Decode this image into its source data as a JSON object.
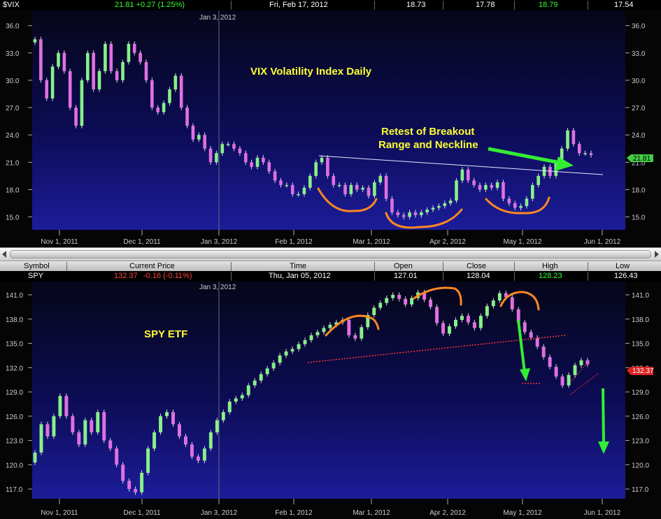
{
  "vix_header": {
    "symbol": "$VIX",
    "change": "21.81 +0.27 (1.25%)",
    "date": "Fri, Feb 17, 2012",
    "open": "18.73",
    "low": "17.78",
    "high": "18.79",
    "close": "17.54"
  },
  "spy_columns": {
    "symbol": "Symbol",
    "current_price": "Current Price",
    "time": "Time",
    "open": "Open",
    "close": "Close",
    "high": "High",
    "low": "Low"
  },
  "spy_header": {
    "symbol": "SPY",
    "price": "132.37",
    "change": "-0.16 (-0.11%)",
    "time": "Thu, Jan 05, 2012",
    "open": "127.01",
    "close": "128.04",
    "high": "128.23",
    "low": "126.43"
  },
  "colors": {
    "background_top": "#0a0a1a",
    "background_bottom": "#16168a",
    "up_candle": "#88f088",
    "down_candle": "#e070e0",
    "annotation_text": "#ffff33",
    "arrow": "#33ee33",
    "arc": "#ff8822",
    "trendline": "#ff3333"
  },
  "chart_data": [
    {
      "type": "candlestick",
      "title": "VIX Volatility Index Daily",
      "annotations": [
        "Retest of Breakout",
        "Range and Neckline"
      ],
      "date_line_label": "Jan 3, 2012",
      "x_ticks": [
        "Nov 1, 2011",
        "Dec 1, 2011",
        "Jan 3, 2012",
        "Feb 1, 2012",
        "Mar 1, 2012",
        "Apr 2, 2012",
        "May 1, 2012",
        "Jun 1, 2012"
      ],
      "y_ticks": [
        "15.0",
        "18.0",
        "21.0",
        "24.0",
        "27.0",
        "30.0",
        "33.0",
        "36.0"
      ],
      "ylim": [
        14.2,
        37.2
      ],
      "last_price_label": "21.81",
      "last_price": 21.81,
      "closes": [
        34.5,
        30,
        28,
        31.5,
        33,
        31,
        27,
        25,
        30,
        33,
        29,
        31,
        34,
        31,
        30,
        32,
        34,
        33,
        32,
        30,
        27,
        26.5,
        27.5,
        29,
        30.5,
        27,
        25,
        23.5,
        24,
        22.5,
        21,
        22,
        23,
        23,
        22.5,
        22,
        21,
        20.5,
        21.5,
        21,
        20,
        19,
        18.5,
        18.5,
        17.5,
        17.5,
        18.2,
        19.5,
        21,
        21.5,
        19.5,
        18.5,
        18.5,
        17.5,
        18.5,
        18,
        18.2,
        17.3,
        18.8,
        19.5,
        17,
        15.5,
        15.2,
        15,
        15.5,
        15.2,
        15.5,
        15.8,
        16,
        16.2,
        16.5,
        16.8,
        19,
        20.2,
        19,
        18.5,
        18,
        18.5,
        18.2,
        18.8,
        17,
        16.5,
        16,
        16.2,
        17,
        18.5,
        19.5,
        20.5,
        19.5,
        21,
        22.5,
        24.5,
        23,
        22,
        22,
        21.8
      ]
    },
    {
      "type": "candlestick",
      "title": "SPY ETF",
      "date_line_label": "Jan 3, 2012",
      "x_ticks": [
        "Nov 1, 2011",
        "Dec 1, 2011",
        "Jan 3, 2012",
        "Feb 1, 2012",
        "Mar 1, 2012",
        "Apr 2, 2012",
        "May 1, 2012",
        "Jun 1, 2012"
      ],
      "y_ticks": [
        "117.0",
        "120.0",
        "123.0",
        "126.0",
        "129.0",
        "132.0",
        "135.0",
        "138.0",
        "141.0"
      ],
      "ylim": [
        116.4,
        142.3
      ],
      "last_price_label": "132.37",
      "last_price": 132.37,
      "closes": [
        121.5,
        125,
        123.5,
        126,
        128.5,
        126,
        124,
        122.5,
        125.5,
        124,
        126.5,
        123,
        122,
        120,
        118,
        117,
        116.6,
        119,
        122,
        124,
        126,
        126.5,
        125,
        123.5,
        122.5,
        121,
        120.5,
        122,
        124,
        125.5,
        126.5,
        127.8,
        128.2,
        128.6,
        129.8,
        130.4,
        131.2,
        131.9,
        132.6,
        133.5,
        134,
        134.3,
        134.9,
        135.4,
        136,
        136.4,
        136.9,
        137.3,
        137.6,
        137.9,
        136,
        135.6,
        137,
        138.5,
        139.4,
        140,
        140.6,
        141,
        140.5,
        139.8,
        140.6,
        141.3,
        140.4,
        139.5,
        137.5,
        136.2,
        137.1,
        137.9,
        138.4,
        137.6,
        136.9,
        138.4,
        139.6,
        140.3,
        141.2,
        140.7,
        139.2,
        137.6,
        136.4,
        135.7,
        134.6,
        133.3,
        132.1,
        130.9,
        129.8,
        131.1,
        132.3,
        132.9,
        132.4
      ]
    }
  ]
}
